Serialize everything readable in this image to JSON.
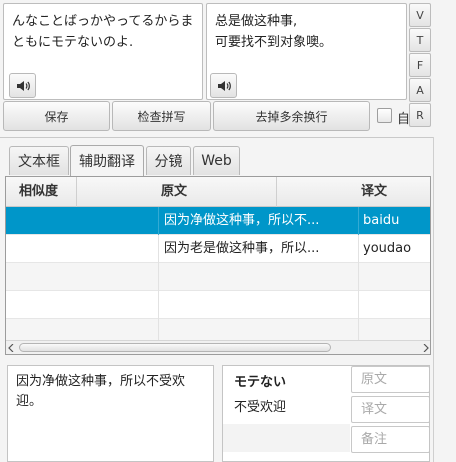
{
  "source_text": "んなことばっかやってるからまともにモテないのよ.",
  "target_text": "总是做这种事,\n可要找不到对象噢。",
  "side_buttons": [
    "V",
    "T",
    "F",
    "A",
    "R"
  ],
  "toolbar": {
    "save": "保存",
    "spellcheck": "检查拼写",
    "remove_newlines": "去掉多余换行",
    "auto_label": "自"
  },
  "tabs": [
    "文本框",
    "辅助翻译",
    "分镜",
    "Web"
  ],
  "table": {
    "headers": [
      "相似度",
      "原文",
      "译文"
    ],
    "rows": [
      {
        "similarity": "",
        "source": "因为净做这种事，所以不...",
        "translation": "baidu"
      },
      {
        "similarity": "",
        "source": "因为老是做这种事，所以...",
        "translation": "youdao"
      }
    ]
  },
  "detail_text": "因为净做这种事，所以不受欢迎。",
  "glossary": {
    "term": "モテない",
    "meaning": "不受欢迎"
  },
  "fields": {
    "source_placeholder": "原文",
    "translation_placeholder": "译文",
    "note_placeholder": "备注"
  }
}
